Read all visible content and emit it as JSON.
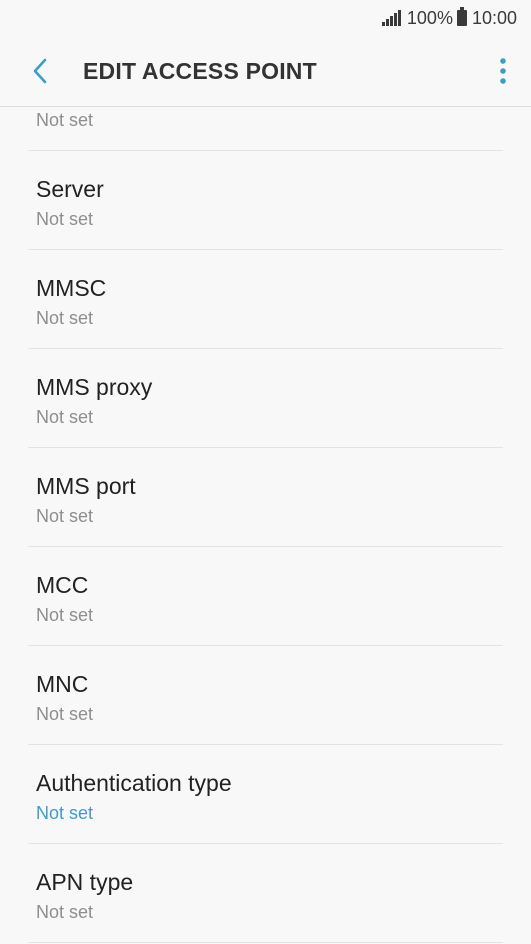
{
  "status_bar": {
    "battery_percent": "100%",
    "time": "10:00",
    "signal_icon": "signal-icon",
    "battery_icon": "battery-icon"
  },
  "app_bar": {
    "title": "EDIT ACCESS POINT",
    "back_icon": "chevron-left-icon",
    "more_icon": "more-vert-icon",
    "accent_color": "#3d9ec4"
  },
  "list": {
    "partial_value": "Not set",
    "items": [
      {
        "label": "Server",
        "value": "Not set"
      },
      {
        "label": "MMSC",
        "value": "Not set"
      },
      {
        "label": "MMS proxy",
        "value": "Not set"
      },
      {
        "label": "MMS port",
        "value": "Not set"
      },
      {
        "label": "MCC",
        "value": "Not set"
      },
      {
        "label": "MNC",
        "value": "Not set"
      },
      {
        "label": "Authentication type",
        "value": "Not set"
      },
      {
        "label": "APN type",
        "value": "Not set"
      }
    ]
  }
}
